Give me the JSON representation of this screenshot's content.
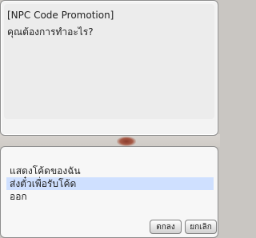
{
  "npc_dialog": {
    "title": "[NPC Code Promotion]",
    "message": "คุณต้องการทำอะไร?"
  },
  "menu": {
    "items": [
      {
        "label": "แสดงโค้ดของฉัน",
        "selected": false
      },
      {
        "label": "ส่งตั๋วเพื่อรับโค้ด",
        "selected": true
      },
      {
        "label": "ออก",
        "selected": false
      }
    ],
    "ok_label": "ตกลง",
    "cancel_label": "ยกเลิก"
  },
  "colors": {
    "selection_highlight": "#cfe0ff",
    "window_background": "#f3f3f3",
    "window_border": "#8e8e8e"
  }
}
